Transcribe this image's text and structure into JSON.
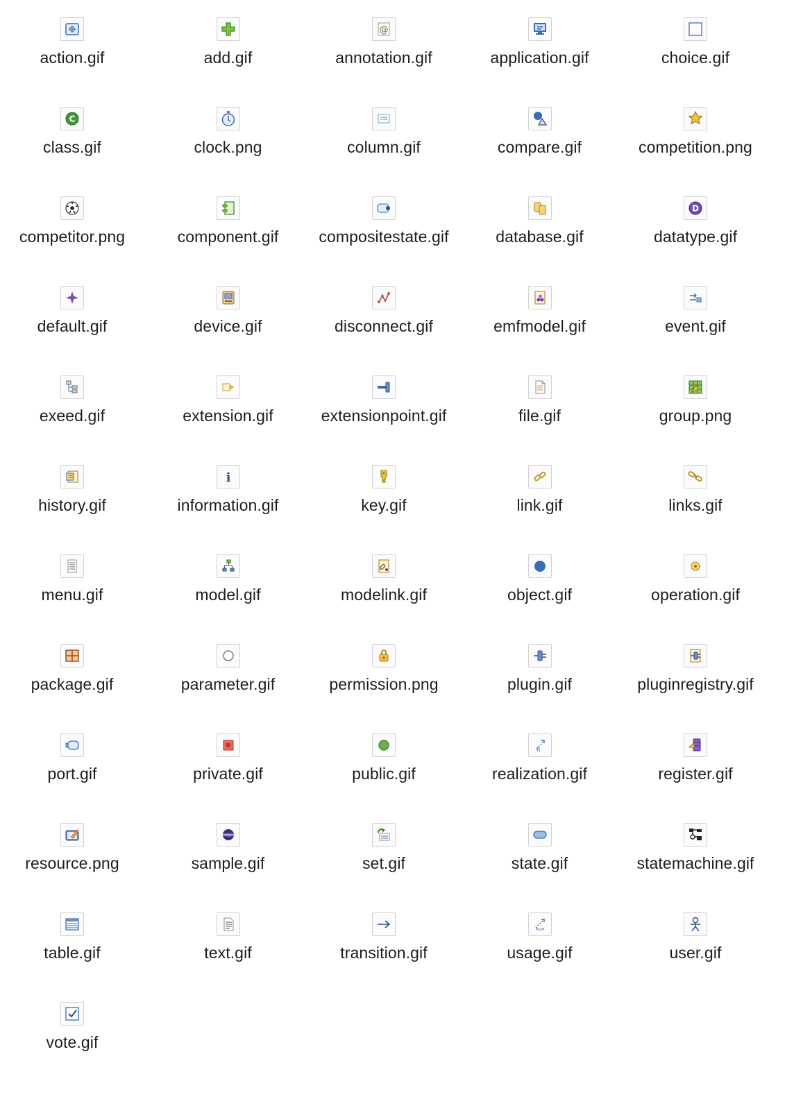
{
  "items": [
    {
      "label": "action.gif",
      "icon": "action-icon"
    },
    {
      "label": "add.gif",
      "icon": "add-icon"
    },
    {
      "label": "annotation.gif",
      "icon": "annotation-icon"
    },
    {
      "label": "application.gif",
      "icon": "application-icon"
    },
    {
      "label": "choice.gif",
      "icon": "choice-icon"
    },
    {
      "label": "class.gif",
      "icon": "class-icon"
    },
    {
      "label": "clock.png",
      "icon": "clock-icon"
    },
    {
      "label": "column.gif",
      "icon": "column-icon"
    },
    {
      "label": "compare.gif",
      "icon": "compare-icon"
    },
    {
      "label": "competition.png",
      "icon": "competition-icon"
    },
    {
      "label": "competitor.png",
      "icon": "competitor-icon"
    },
    {
      "label": "component.gif",
      "icon": "component-icon"
    },
    {
      "label": "compositestate.gif",
      "icon": "compositestate-icon"
    },
    {
      "label": "database.gif",
      "icon": "database-icon"
    },
    {
      "label": "datatype.gif",
      "icon": "datatype-icon"
    },
    {
      "label": "default.gif",
      "icon": "default-icon"
    },
    {
      "label": "device.gif",
      "icon": "device-icon"
    },
    {
      "label": "disconnect.gif",
      "icon": "disconnect-icon"
    },
    {
      "label": "emfmodel.gif",
      "icon": "emfmodel-icon"
    },
    {
      "label": "event.gif",
      "icon": "event-icon"
    },
    {
      "label": "exeed.gif",
      "icon": "exeed-icon"
    },
    {
      "label": "extension.gif",
      "icon": "extension-icon"
    },
    {
      "label": "extensionpoint.gif",
      "icon": "extensionpoint-icon"
    },
    {
      "label": "file.gif",
      "icon": "file-icon"
    },
    {
      "label": "group.png",
      "icon": "group-icon"
    },
    {
      "label": "history.gif",
      "icon": "history-icon"
    },
    {
      "label": "information.gif",
      "icon": "information-icon"
    },
    {
      "label": "key.gif",
      "icon": "key-icon"
    },
    {
      "label": "link.gif",
      "icon": "link-icon"
    },
    {
      "label": "links.gif",
      "icon": "links-icon"
    },
    {
      "label": "menu.gif",
      "icon": "menu-icon"
    },
    {
      "label": "model.gif",
      "icon": "model-icon"
    },
    {
      "label": "modelink.gif",
      "icon": "modelink-icon"
    },
    {
      "label": "object.gif",
      "icon": "object-icon"
    },
    {
      "label": "operation.gif",
      "icon": "operation-icon"
    },
    {
      "label": "package.gif",
      "icon": "package-icon"
    },
    {
      "label": "parameter.gif",
      "icon": "parameter-icon"
    },
    {
      "label": "permission.png",
      "icon": "permission-icon"
    },
    {
      "label": "plugin.gif",
      "icon": "plugin-icon"
    },
    {
      "label": "pluginregistry.gif",
      "icon": "pluginregistry-icon"
    },
    {
      "label": "port.gif",
      "icon": "port-icon"
    },
    {
      "label": "private.gif",
      "icon": "private-icon"
    },
    {
      "label": "public.gif",
      "icon": "public-icon"
    },
    {
      "label": "realization.gif",
      "icon": "realization-icon"
    },
    {
      "label": "register.gif",
      "icon": "register-icon"
    },
    {
      "label": "resource.png",
      "icon": "resource-icon"
    },
    {
      "label": "sample.gif",
      "icon": "sample-icon"
    },
    {
      "label": "set.gif",
      "icon": "set-icon"
    },
    {
      "label": "state.gif",
      "icon": "state-icon"
    },
    {
      "label": "statemachine.gif",
      "icon": "statemachine-icon"
    },
    {
      "label": "table.gif",
      "icon": "table-icon"
    },
    {
      "label": "text.gif",
      "icon": "text-icon"
    },
    {
      "label": "transition.gif",
      "icon": "transition-icon"
    },
    {
      "label": "usage.gif",
      "icon": "usage-icon"
    },
    {
      "label": "user.gif",
      "icon": "user-icon"
    },
    {
      "label": "vote.gif",
      "icon": "vote-icon"
    }
  ]
}
